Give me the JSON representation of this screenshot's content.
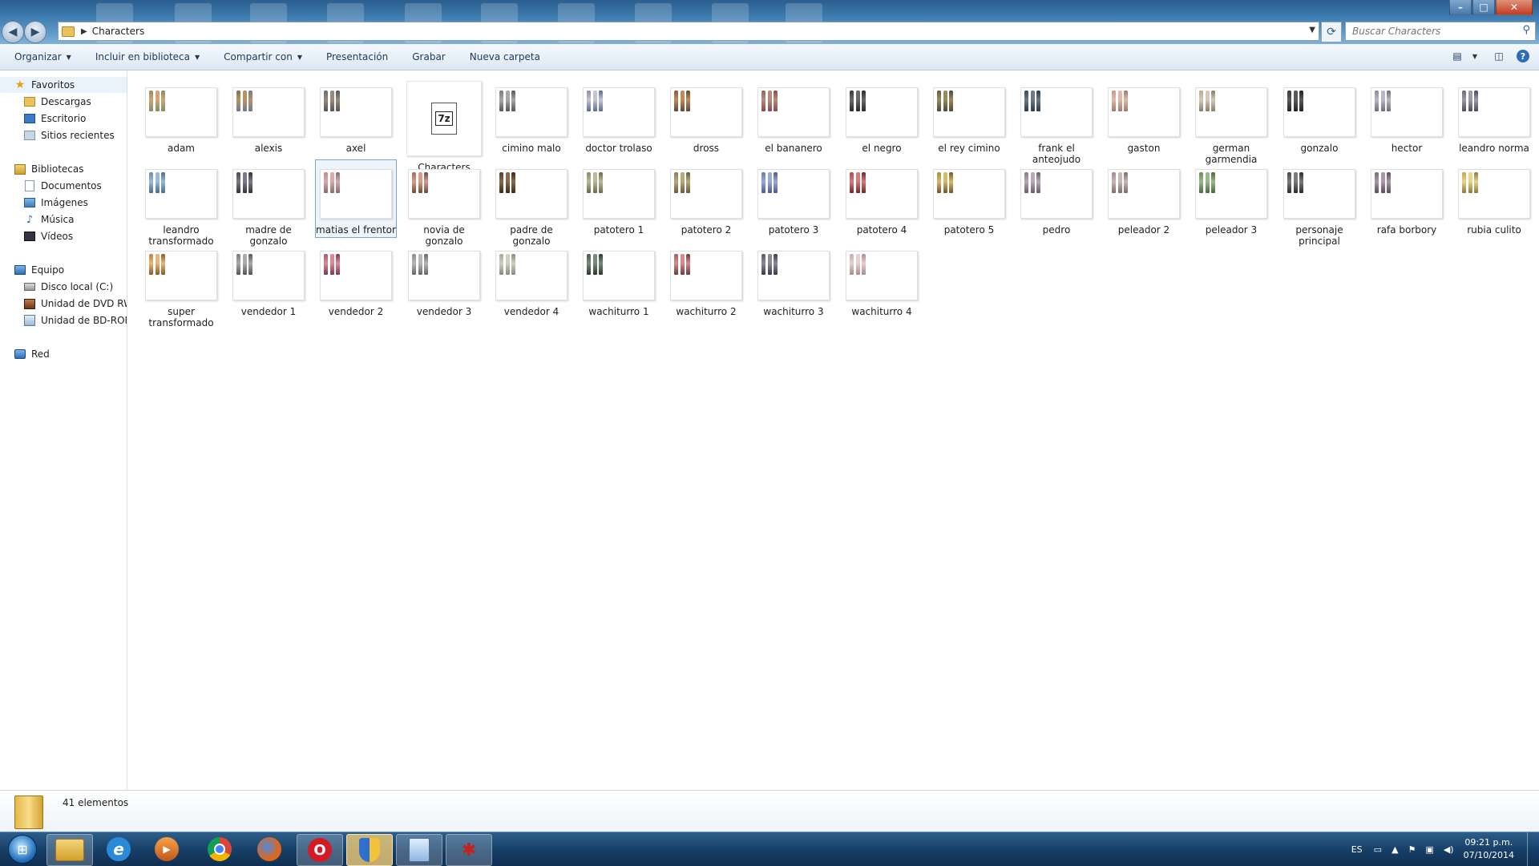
{
  "address": {
    "path": "Characters"
  },
  "search": {
    "placeholder": "Buscar Characters"
  },
  "commandbar": {
    "items": [
      "Organizar",
      "Incluir en biblioteca",
      "Compartir con",
      "Presentación",
      "Grabar",
      "Nueva carpeta"
    ]
  },
  "nav": {
    "favorites": {
      "label": "Favoritos",
      "items": [
        "Descargas",
        "Escritorio",
        "Sitios recientes"
      ]
    },
    "libraries": {
      "label": "Bibliotecas",
      "items": [
        "Documentos",
        "Imágenes",
        "Música",
        "Vídeos"
      ]
    },
    "computer": {
      "label": "Equipo",
      "items": [
        "Disco local (C:)",
        "Unidad de DVD RW (",
        "Unidad de BD-ROM"
      ]
    },
    "network": {
      "label": "Red"
    }
  },
  "files": [
    {
      "name": "adam",
      "palette": [
        "#a38a5c",
        "#cfa478",
        "#7d8f6a"
      ]
    },
    {
      "name": "alexis",
      "palette": [
        "#7d6d52",
        "#b89360",
        "#6f7b8f"
      ]
    },
    {
      "name": "axel",
      "palette": [
        "#6a6a6a",
        "#9a8a7a",
        "#555"
      ]
    },
    {
      "name": "Characters",
      "type": "archive",
      "badge": "7z"
    },
    {
      "name": "cimino malo",
      "palette": [
        "#7a7a7a",
        "#a8a8a8",
        "#555"
      ]
    },
    {
      "name": "doctor trolaso",
      "palette": [
        "#8c8c9c",
        "#c4c4d8",
        "#5c6c8c"
      ]
    },
    {
      "name": "dross",
      "palette": [
        "#8a5a3a",
        "#c48a5a",
        "#5a4a3a"
      ]
    },
    {
      "name": "el bananero",
      "palette": [
        "#8a6a5a",
        "#b88a7a",
        "#8a4a4a"
      ]
    },
    {
      "name": "el negro",
      "palette": [
        "#3a3a3a",
        "#6a6a6a",
        "#2a2a2a"
      ]
    },
    {
      "name": "el rey cimino",
      "palette": [
        "#6a5a3a",
        "#9a8a5a",
        "#4a4a3a"
      ]
    },
    {
      "name": "frank el anteojudo",
      "palette": [
        "#3a4a5a",
        "#6a7a8a",
        "#2a3a4a"
      ]
    },
    {
      "name": "gaston",
      "palette": [
        "#c49a8a",
        "#e4b8a8",
        "#9a7a6a"
      ]
    },
    {
      "name": "german garmendia",
      "palette": [
        "#b8a898",
        "#d8c8b8",
        "#8a7a6a"
      ]
    },
    {
      "name": "gonzalo",
      "palette": [
        "#3a3a3a",
        "#5a5a5a",
        "#222"
      ]
    },
    {
      "name": "hector",
      "palette": [
        "#8a8a9a",
        "#b8b8c8",
        "#6a6a7a"
      ]
    },
    {
      "name": "leandro norma",
      "palette": [
        "#6a6a7a",
        "#9a9aa8",
        "#4a4a5a"
      ]
    },
    {
      "name": "leandro transformado",
      "palette": [
        "#6a8aaa",
        "#9abad8",
        "#4a6a8a"
      ]
    },
    {
      "name": "madre de gonzalo",
      "palette": [
        "#4a4a5a",
        "#7a7a8a",
        "#333"
      ]
    },
    {
      "name": "matias el frentor",
      "palette": [
        "#b88a8a",
        "#d8aaaa",
        "#8a6a6a"
      ]
    },
    {
      "name": "novia de gonzalo",
      "palette": [
        "#a86a5a",
        "#d89a8a",
        "#6a4a3a"
      ]
    },
    {
      "name": "padre de gonzalo",
      "palette": [
        "#5a3a2a",
        "#8a6a4a",
        "#3a2a1a"
      ]
    },
    {
      "name": "patotero 1",
      "palette": [
        "#8a8a6a",
        "#b8b89a",
        "#6a6a4a"
      ]
    },
    {
      "name": "patotero 2",
      "palette": [
        "#8a7a5a",
        "#b8a87a",
        "#6a5a3a"
      ]
    },
    {
      "name": "patotero 3",
      "palette": [
        "#6a7aaa",
        "#9aaad8",
        "#4a5a8a"
      ]
    },
    {
      "name": "patotero 4",
      "palette": [
        "#aa4a4a",
        "#d87a7a",
        "#6a2a2a"
      ]
    },
    {
      "name": "patotero 5",
      "palette": [
        "#aa8a3a",
        "#d8b86a",
        "#6a5a2a"
      ]
    },
    {
      "name": "pedro",
      "palette": [
        "#8a7a8a",
        "#b8a8b8",
        "#6a5a6a"
      ]
    },
    {
      "name": "peleador 2",
      "palette": [
        "#9a8a8a",
        "#c8b8b8",
        "#7a6a6a"
      ]
    },
    {
      "name": "peleador 3",
      "palette": [
        "#6a8a5a",
        "#9ab88a",
        "#4a6a3a"
      ]
    },
    {
      "name": "personaje principal",
      "palette": [
        "#4a4a4a",
        "#7a7a7a",
        "#2a2a2a"
      ]
    },
    {
      "name": "rafa borbory",
      "palette": [
        "#7a6a7a",
        "#a898a8",
        "#5a4a5a"
      ]
    },
    {
      "name": "rubia culito",
      "palette": [
        "#c4a44a",
        "#e8d48a",
        "#8a7a3a"
      ]
    },
    {
      "name": "super transformado",
      "palette": [
        "#b8844a",
        "#e8b47a",
        "#8a5a2a"
      ]
    },
    {
      "name": "vendedor 1",
      "palette": [
        "#7a7a7a",
        "#aaaaaa",
        "#555"
      ]
    },
    {
      "name": "vendedor 2",
      "palette": [
        "#aa5a6a",
        "#d88a9a",
        "#7a3a4a"
      ]
    },
    {
      "name": "vendedor 3",
      "palette": [
        "#8a8a8a",
        "#b8b8b8",
        "#666"
      ]
    },
    {
      "name": "vendedor 4",
      "palette": [
        "#a8a898",
        "#d0d0c0",
        "#8a8a7a"
      ]
    },
    {
      "name": "wachiturro 1",
      "palette": [
        "#4a5a4a",
        "#7a8a7a",
        "#2a3a2a"
      ]
    },
    {
      "name": "wachiturro 2",
      "palette": [
        "#aa5a5a",
        "#d88a8a",
        "#6a3a3a"
      ]
    },
    {
      "name": "wachiturro 3",
      "palette": [
        "#5a5a6a",
        "#8a8a9a",
        "#3a3a4a"
      ]
    },
    {
      "name": "wachiturro 4",
      "palette": [
        "#c8aaaa",
        "#e8d0d0",
        "#a88a8a"
      ]
    }
  ],
  "selected_file": "matias el frentor",
  "status": {
    "count": "41 elementos"
  },
  "taskbar": {
    "apps": [
      "explorer",
      "internet-explorer",
      "media-player",
      "chrome",
      "firefox",
      "opera",
      "security",
      "notepad",
      "game"
    ],
    "language": "ES",
    "time": "09:21 p.m.",
    "date": "07/10/2014"
  }
}
